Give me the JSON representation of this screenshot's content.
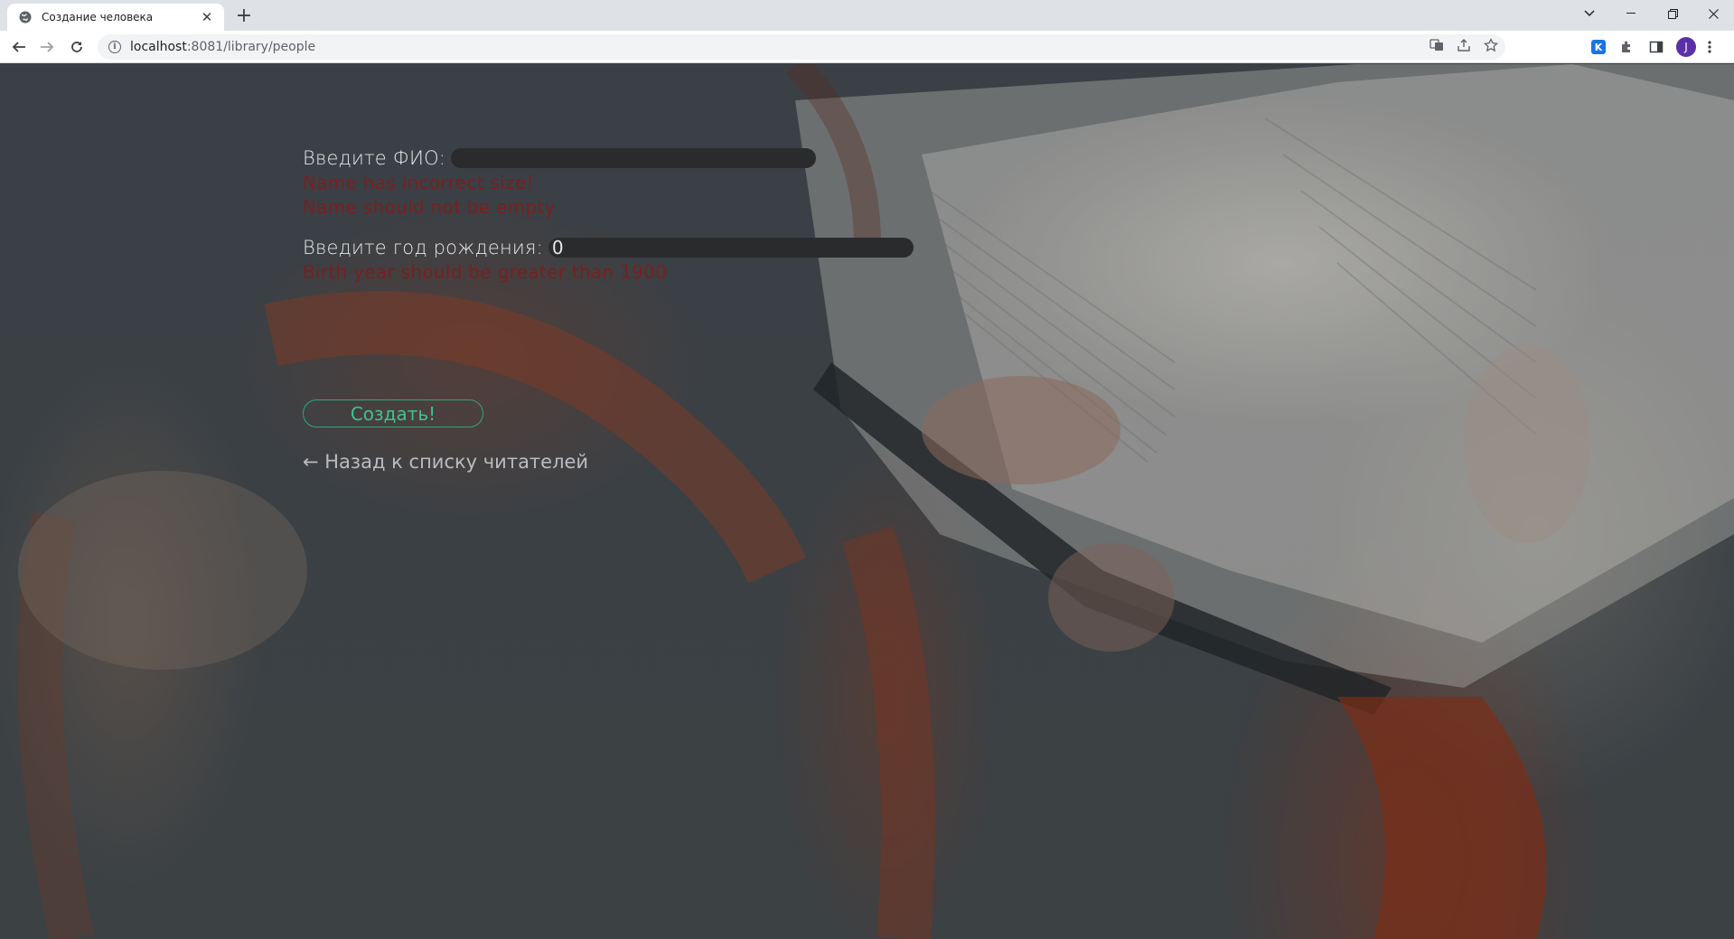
{
  "browser": {
    "tab_title": "Создание человека",
    "tab_close": "✕",
    "new_tab": "+",
    "url_host": "localhost",
    "url_path": ":8081/library/people",
    "avatar_letter": "J",
    "extension_letter": "K"
  },
  "form": {
    "name_label": "Введите ФИО:",
    "name_value": "",
    "name_errors": [
      "Name has incorrect size!",
      "Name should not be empty"
    ],
    "year_label": "Введите год рождения:",
    "year_value": "0",
    "year_errors": [
      "Birth year should be greater than 1900"
    ],
    "submit_label": "Создать!",
    "back_link": "← Назад к списку читателей"
  },
  "colors": {
    "error_text": "#7a1f1f",
    "button_accent": "#2ea97a",
    "label_text": "#e6e6e6",
    "page_overlay": "#3a4045"
  }
}
